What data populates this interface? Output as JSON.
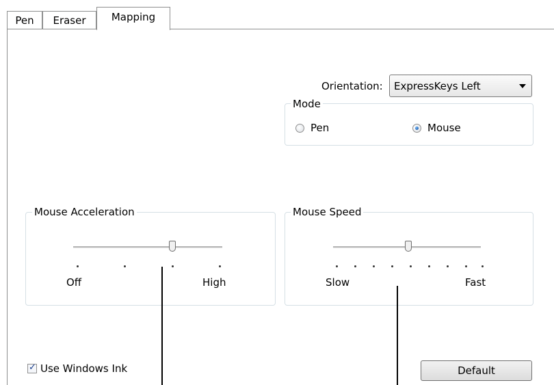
{
  "tabs": [
    {
      "label": "Pen"
    },
    {
      "label": "Eraser"
    },
    {
      "label": "Mapping",
      "active": true
    }
  ],
  "orientation": {
    "label": "Orientation:",
    "selected": "ExpressKeys Left"
  },
  "mode": {
    "title": "Mode",
    "options": [
      {
        "label": "Pen",
        "checked": false
      },
      {
        "label": "Mouse",
        "checked": true
      }
    ]
  },
  "mouse_acceleration": {
    "title": "Mouse Acceleration",
    "min_label": "Off",
    "max_label": "High",
    "tick_count": 4,
    "value_index": 2
  },
  "mouse_speed": {
    "title": "Mouse Speed",
    "min_label": "Slow",
    "max_label": "Fast",
    "tick_count": 9,
    "value_index": 4
  },
  "use_windows_ink": {
    "label": "Use Windows Ink",
    "checked": true
  },
  "default_button": {
    "label": "Default"
  },
  "colors": {
    "border": "#8e8f8f",
    "group_border": "#d5dfe5",
    "radio_dot": "#1a5fc4"
  }
}
